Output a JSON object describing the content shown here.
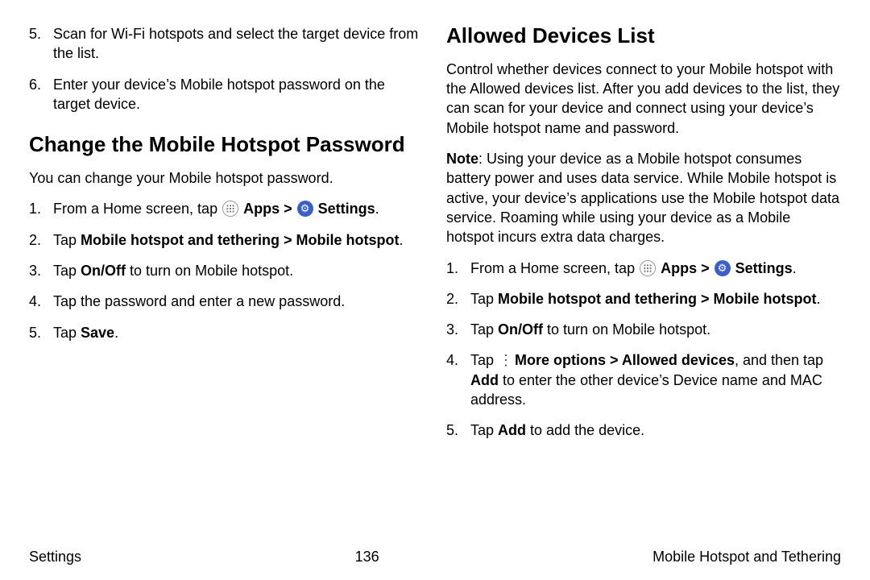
{
  "left": {
    "steps_continued": [
      "Scan for Wi-Fi hotspots and select the target device from the list.",
      "Enter your device’s Mobile hotspot password on the target device."
    ],
    "h2": "Change the Mobile Hotspot Password",
    "intro": "You can change your Mobile hotspot password.",
    "steps": {
      "s1_pre": "From a Home screen, tap ",
      "s1_apps": "Apps",
      "s1_arrow": " > ",
      "s1_settings": "Settings",
      "s1_post": ".",
      "s2_pre": "Tap ",
      "s2_b1": "Mobile hotspot and tethering",
      "s2_arrow": " > ",
      "s2_b2": "Mobile hotspot",
      "s2_post": ".",
      "s3_pre": "Tap ",
      "s3_b": "On/Off",
      "s3_post": " to turn on Mobile hotspot.",
      "s4": "Tap the password and enter a new password.",
      "s5_pre": "Tap ",
      "s5_b": "Save",
      "s5_post": "."
    }
  },
  "right": {
    "h2": "Allowed Devices List",
    "p1": "Control whether devices connect to your Mobile hotspot with the Allowed devices list. After you add devices to the list, they can scan for your device and connect using your device’s Mobile hotspot name and password.",
    "note_label": "Note",
    "note_body": ": Using your device as a Mobile hotspot consumes battery power and uses data service. While Mobile hotspot is active, your device’s applications use the Mobile hotspot data service. Roaming while using your device as a Mobile hotspot incurs extra data charges.",
    "steps": {
      "s1_pre": "From a Home screen, tap ",
      "s1_apps": "Apps",
      "s1_arrow": " > ",
      "s1_settings": "Settings",
      "s1_post": ".",
      "s2_pre": "Tap ",
      "s2_b1": "Mobile hotspot and tethering",
      "s2_arrow": " > ",
      "s2_b2": "Mobile hotspot",
      "s2_post": ".",
      "s3_pre": "Tap ",
      "s3_b": "On/Off",
      "s3_post": " to turn on Mobile hotspot.",
      "s4_pre": "Tap ",
      "s4_b1": "More options",
      "s4_arrow": " > ",
      "s4_b2": "Allowed devices",
      "s4_mid": ", and then tap ",
      "s4_b3": "Add",
      "s4_post": " to enter the other device’s Device name and MAC address.",
      "s5_pre": "Tap ",
      "s5_b": "Add",
      "s5_post": " to add the device."
    }
  },
  "footer": {
    "left": "Settings",
    "page": "136",
    "right": "Mobile Hotspot and Tethering"
  }
}
